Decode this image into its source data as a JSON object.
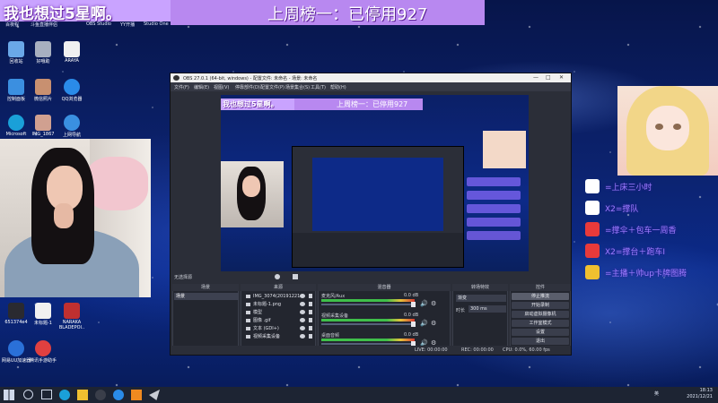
{
  "stream": {
    "overlay_left": "我也想过5星啊。",
    "overlay_center": "上周榜一：已停用927",
    "right_badges": [
      "=上床三小时",
      "X2=撑队",
      "=撑伞＋包车一周香",
      "X2=撑台＋跑车Ⅰ",
      "=主播＋帅up卡牌图腾"
    ]
  },
  "desktop": {
    "top_labels": [
      "百夜程",
      "斗鱼直播伴侣",
      "OBS Studio",
      "YY开播",
      "Studio One"
    ],
    "left_icons": [
      {
        "label": "回收站",
        "icon": "recycle-bin-icon",
        "color": "#6aa8e8"
      },
      {
        "label": "好哦助",
        "icon": "app-icon",
        "color": "#a8b0c0"
      },
      {
        "label": "ARAYA",
        "icon": "file-icon",
        "color": "#f0f0f0"
      },
      {
        "label": "控制面板",
        "icon": "control-panel-icon",
        "color": "#3b8fe0"
      },
      {
        "label": "微信照片",
        "icon": "photo-icon",
        "color": "#c89070"
      },
      {
        "label": "QQ浏览器",
        "icon": "browser-icon",
        "color": "#2a8be8"
      },
      {
        "label": "Microsoft",
        "icon": "edge-icon",
        "color": "#1aa0d8"
      },
      {
        "label": "IMG_1867",
        "icon": "image-icon",
        "color": "#d0a090"
      },
      {
        "label": "上网导航",
        "icon": "ie-icon",
        "color": "#3a90e0"
      },
      {
        "label": "651374e4",
        "icon": "avatar-icon",
        "color": "#2a2a30"
      },
      {
        "label": "未标题-1",
        "icon": "psd-icon",
        "color": "#f0f0f0"
      },
      {
        "label": "NARAKA BLADEPOI..",
        "icon": "game-icon",
        "color": "#c03030"
      },
      {
        "label": "网易UU加速器",
        "icon": "uu-icon",
        "color": "#2a70d8"
      },
      {
        "label": "腾讯手游助手",
        "icon": "tencent-icon",
        "color": "#e04040"
      }
    ]
  },
  "obs": {
    "title": "OBS 27.0.1 (64-bit, windows) - 配置文件: 未命名 - 场景: 未命名",
    "menu": [
      "文件(F)",
      "编辑(E)",
      "视图(V)",
      "停靠部件(D)",
      "配置文件(P)",
      "场景集合(S)",
      "工具(T)",
      "帮助(H)"
    ],
    "preview_bar": "无选择源",
    "scenes": {
      "header": "场景",
      "items": [
        "场景"
      ]
    },
    "sources": {
      "header": "来源",
      "items": [
        {
          "label": "IMG_3074(20191221..."
        },
        {
          "label": "未标题-1.png"
        },
        {
          "label": "模型"
        },
        {
          "label": "图像 .gif"
        },
        {
          "label": "文本 (GDI+)"
        },
        {
          "label": "视频采集设备"
        }
      ]
    },
    "mixer": {
      "header": "混音器",
      "channels": [
        {
          "name": "麦克风/Aux",
          "db": "0.0 dB"
        },
        {
          "name": "视频采集设备",
          "db": "0.0 dB"
        },
        {
          "name": "桌面音频",
          "db": "0.0 dB"
        }
      ]
    },
    "transitions": {
      "header": "转场特效",
      "type": "渐变",
      "duration_label": "时长",
      "duration": "300 ms"
    },
    "controls": {
      "header": "控件",
      "buttons": [
        "停止推流",
        "开始录制",
        "启动虚拟摄像机",
        "工作室模式",
        "设置",
        "退出"
      ]
    },
    "status": {
      "live": "LIVE: 00:00:00",
      "rec": "REC: 00:00:00",
      "cpu": "CPU: 0.0%, 60.00 fps"
    }
  },
  "taskbar": {
    "time": "18:13",
    "date": "2021/12/21",
    "ime": "英",
    "colors": {
      "bg": "#1d2433"
    }
  }
}
